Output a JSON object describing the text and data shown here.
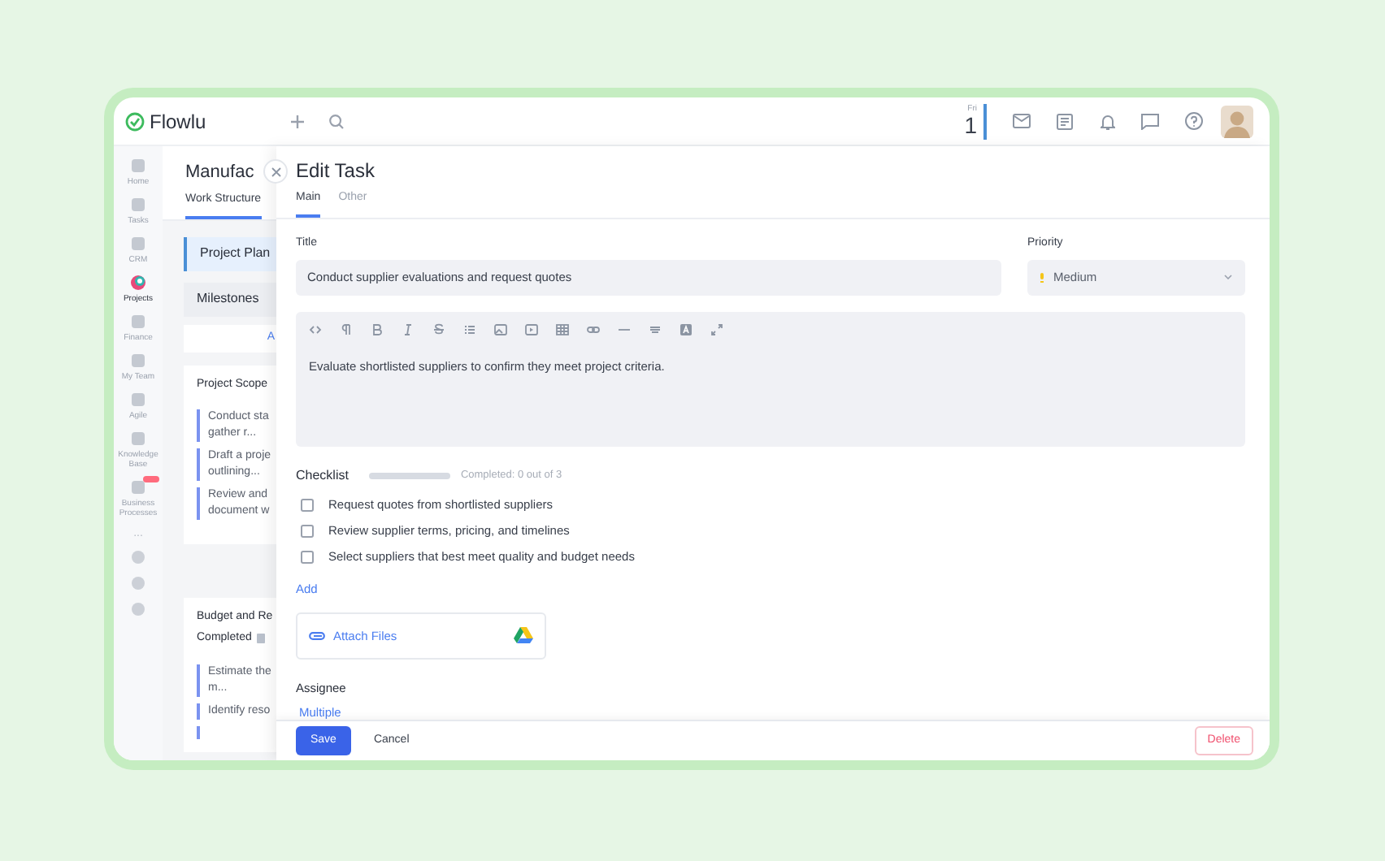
{
  "app": {
    "logo": "Flowlu"
  },
  "calendar": {
    "weekday": "Fri",
    "day": "1"
  },
  "sidebar": {
    "items": [
      {
        "label": "Home",
        "selected": false,
        "badge": false
      },
      {
        "label": "Tasks",
        "selected": false,
        "badge": false
      },
      {
        "label": "CRM",
        "selected": false,
        "badge": false
      },
      {
        "label": "Projects",
        "selected": true,
        "badge": false
      },
      {
        "label": "Finance",
        "selected": false,
        "badge": false
      },
      {
        "label": "My Team",
        "selected": false,
        "badge": false
      },
      {
        "label": "Agile",
        "selected": false,
        "badge": false
      },
      {
        "label": "Knowledge Base",
        "selected": false,
        "badge": false
      },
      {
        "label": "Business Processes",
        "selected": false,
        "badge": true
      }
    ],
    "more": "..."
  },
  "project": {
    "title": "Manufac",
    "tabs": [
      {
        "label": "Work Structure",
        "selected": true
      }
    ],
    "sections": [
      {
        "label": "Project Plan",
        "selected": true
      },
      {
        "label": "Milestones",
        "selected": false
      }
    ],
    "add_link": "A",
    "cards": [
      {
        "title": "Project Scope",
        "tasks": [
          [
            "Conduct sta",
            "gather r..."
          ],
          [
            "Draft a proje",
            "outlining..."
          ],
          [
            "Review and",
            "document w"
          ]
        ]
      },
      {
        "title": "Budget and Re",
        "status": "Completed",
        "tasks": [
          [
            "Estimate the",
            "m..."
          ],
          [
            "Identify reso"
          ]
        ]
      }
    ]
  },
  "task_editor": {
    "title": "Edit Task",
    "tabs": [
      {
        "label": "Main",
        "selected": true
      },
      {
        "label": "Other",
        "selected": false
      }
    ],
    "title_label": "Title",
    "title_value": "Conduct supplier evaluations and request quotes",
    "priority_label": "Priority",
    "priority_value": "Medium",
    "description": "Evaluate shortlisted suppliers to confirm they meet project criteria.",
    "checklist": {
      "label": "Checklist",
      "level": 0,
      "summary": "Completed: 0 out of 3",
      "items": [
        {
          "text": "Request quotes from shortlisted suppliers",
          "checked": false
        },
        {
          "text": "Review supplier terms, pricing, and timelines",
          "checked": false
        },
        {
          "text": "Select suppliers that best meet quality and budget needs",
          "checked": false
        }
      ],
      "add": "Add"
    },
    "attach": "Attach Files",
    "assignee_label": "Assignee",
    "assignee_value": "Multiple",
    "buttons": {
      "save": "Save",
      "cancel": "Cancel",
      "delete": "Delete"
    }
  }
}
